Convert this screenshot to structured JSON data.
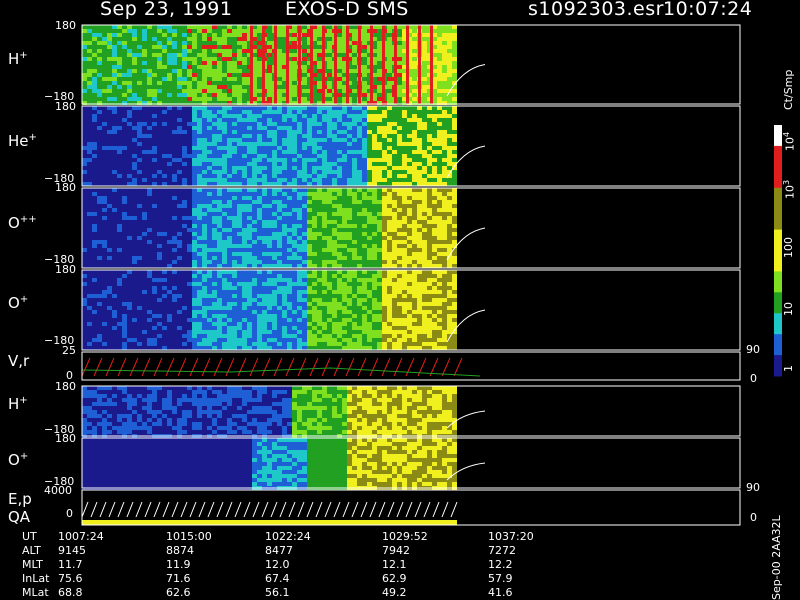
{
  "header": {
    "date": "Sep 23, 1991",
    "instrument": "EXOS-D SMS",
    "file": "s1092303.esr",
    "time": "10:07:24"
  },
  "panels": [
    {
      "label_main": "H",
      "label_sup": "+",
      "ytop": "180",
      "ybot": "−180"
    },
    {
      "label_main": "He",
      "label_sup": "+",
      "ytop": "180",
      "ybot": "−180"
    },
    {
      "label_main": "O",
      "label_sup": "++",
      "ytop": "180",
      "ybot": "−180"
    },
    {
      "label_main": "O",
      "label_sup": "+",
      "ytop": "180",
      "ybot": "−180"
    },
    {
      "label_main": "V,r",
      "label_sup": "",
      "ytop": "25",
      "ybot": "0",
      "right_top": "90",
      "right_bot": "0"
    },
    {
      "label_main": "H",
      "label_sup": "+",
      "ytop": "180",
      "ybot": "−180"
    },
    {
      "label_main": "O",
      "label_sup": "+",
      "ytop": "180",
      "ybot": "−180"
    },
    {
      "label_main": "E,p",
      "label_sup": "",
      "label2": "QA",
      "ytop": "4000",
      "ybot": "0",
      "right_top": "90",
      "right_bot": "0"
    }
  ],
  "colorbar": {
    "title": "Ct/Smp",
    "ticks": [
      {
        "base": "10",
        "exp": "4"
      },
      {
        "base": "10",
        "exp": "3"
      },
      {
        "base": "100",
        "exp": ""
      },
      {
        "base": "10",
        "exp": ""
      },
      {
        "base": "1",
        "exp": ""
      }
    ]
  },
  "footer": {
    "rows": [
      {
        "name": "UT",
        "values": [
          "1007:24",
          "1015:00",
          "1022:24",
          "1029:52",
          "1037:20"
        ]
      },
      {
        "name": "ALT",
        "values": [
          "9145",
          "8874",
          "8477",
          "7942",
          "7272"
        ]
      },
      {
        "name": "MLT",
        "values": [
          "11.7",
          "11.9",
          "12.0",
          "12.1",
          "12.2"
        ]
      },
      {
        "name": "InLat",
        "values": [
          "75.6",
          "71.6",
          "67.4",
          "62.9",
          "57.9"
        ]
      },
      {
        "name": "MLat",
        "values": [
          "68.8",
          "62.6",
          "56.1",
          "49.2",
          "41.6"
        ]
      }
    ],
    "side_note": "Sep-00 2AA32L"
  },
  "chart_data": {
    "type": "heatmap",
    "title": "Sep 23, 1991   EXOS-D SMS",
    "x_ut_ticks": [
      "1007:24",
      "1015:00",
      "1022:24",
      "1029:52",
      "1037:20"
    ],
    "colorbar_units": "Ct/Smp",
    "colorbar_range": [
      1,
      10000
    ],
    "colorbar_scale": "log",
    "colors": {
      "dark_blue": "#1a1a8c",
      "blue": "#1e5fd6",
      "cyan": "#1ec8c8",
      "green": "#22a022",
      "light_green": "#7ee01e",
      "yellow": "#f0f01e",
      "olive": "#8a8a14",
      "red": "#e01e1e",
      "white": "#ffffff"
    },
    "series": [
      {
        "name": "H+",
        "yrange": [
          -180,
          180
        ]
      },
      {
        "name": "He+",
        "yrange": [
          -180,
          180
        ]
      },
      {
        "name": "O++",
        "yrange": [
          -180,
          180
        ]
      },
      {
        "name": "O+",
        "yrange": [
          -180,
          180
        ]
      },
      {
        "name": "V,r",
        "yrange": [
          0,
          25
        ],
        "right_range": [
          0,
          90
        ]
      },
      {
        "name": "H+",
        "yrange": [
          -180,
          180
        ]
      },
      {
        "name": "O+",
        "yrange": [
          -180,
          180
        ]
      },
      {
        "name": "E,p",
        "yrange": [
          0,
          4000
        ],
        "right_range": [
          0,
          90
        ]
      }
    ]
  }
}
